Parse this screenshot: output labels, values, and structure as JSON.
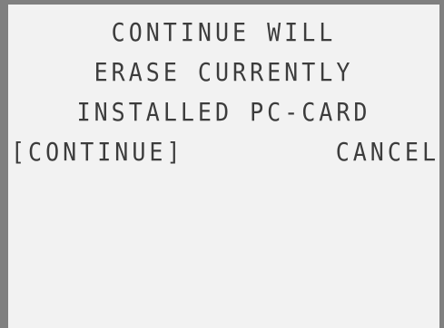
{
  "dialog": {
    "message_lines": [
      "CONTINUE WILL",
      "ERASE CURRENTLY",
      "INSTALLED PC-CARD"
    ],
    "options": {
      "continue_label": "[CONTINUE]",
      "cancel_label": "CANCEL",
      "selected": "continue"
    }
  }
}
